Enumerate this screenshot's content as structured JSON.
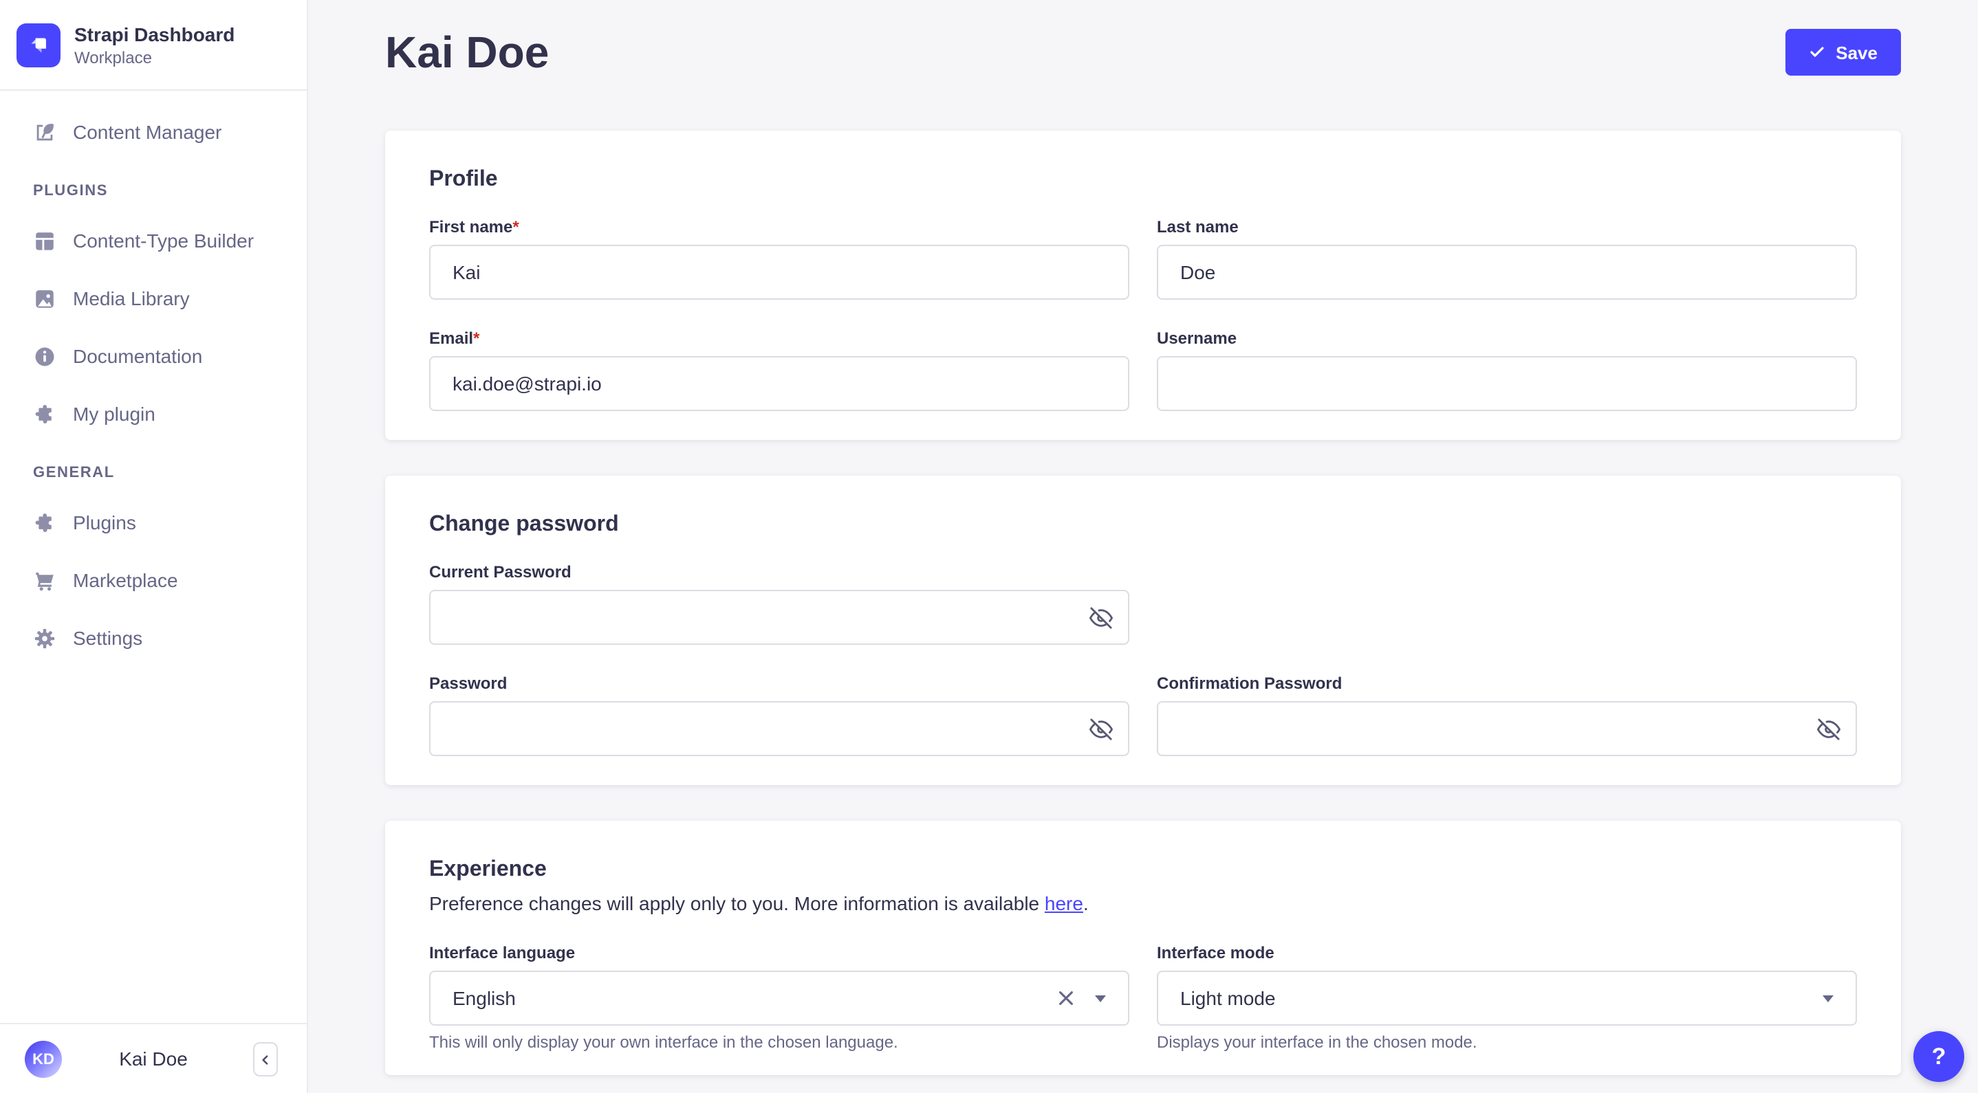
{
  "brand": {
    "name": "Strapi Dashboard",
    "workspace": "Workplace"
  },
  "sidebar": {
    "content_manager": {
      "label": "Content Manager"
    },
    "sections": [
      {
        "title": "PLUGINS",
        "items": [
          {
            "label": "Content-Type Builder"
          },
          {
            "label": "Media Library"
          },
          {
            "label": "Documentation"
          },
          {
            "label": "My plugin"
          }
        ]
      },
      {
        "title": "GENERAL",
        "items": [
          {
            "label": "Plugins"
          },
          {
            "label": "Marketplace"
          },
          {
            "label": "Settings"
          }
        ]
      }
    ],
    "user": {
      "initials": "KD",
      "name": "Kai Doe"
    }
  },
  "header": {
    "title": "Kai Doe",
    "save_label": "Save"
  },
  "profile": {
    "title": "Profile",
    "first_name": {
      "label": "First name",
      "required": "*",
      "value": "Kai"
    },
    "last_name": {
      "label": "Last name",
      "value": "Doe"
    },
    "email": {
      "label": "Email",
      "required": "*",
      "value": "kai.doe@strapi.io"
    },
    "username": {
      "label": "Username",
      "value": ""
    }
  },
  "password": {
    "title": "Change password",
    "current": {
      "label": "Current Password"
    },
    "new": {
      "label": "Password"
    },
    "confirm": {
      "label": "Confirmation Password"
    }
  },
  "experience": {
    "title": "Experience",
    "description_prefix": "Preference changes will apply only to you. More information is available ",
    "link_text": "here",
    "description_suffix": ".",
    "language": {
      "label": "Interface language",
      "value": "English",
      "hint": "This will only display your own interface in the chosen language."
    },
    "mode": {
      "label": "Interface mode",
      "value": "Light mode",
      "hint": "Displays your interface in the chosen mode."
    }
  },
  "help": {
    "label": "?"
  },
  "colors": {
    "primary": "#4945ff",
    "background": "#f6f6f9",
    "text_dark": "#32324d",
    "text_muted": "#666687",
    "border": "#dcdce4",
    "danger": "#d02b20"
  }
}
